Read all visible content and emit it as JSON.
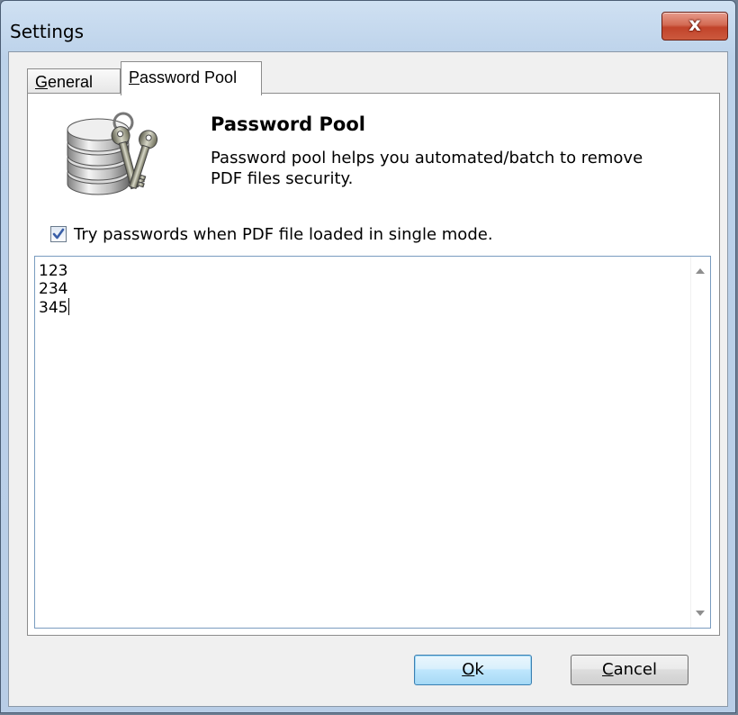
{
  "window": {
    "title": "Settings",
    "close_glyph": "x"
  },
  "tabs": [
    {
      "mnemonic": "G",
      "rest": "eneral",
      "active": false
    },
    {
      "mnemonic": "P",
      "rest": "assword Pool",
      "active": true
    }
  ],
  "panel": {
    "heading": "Password Pool",
    "description": "Password pool helps you automated/batch to remove PDF files security.",
    "icon": "database-keys-icon"
  },
  "checkbox": {
    "label": "Try passwords when PDF file loaded in single mode.",
    "checked": true
  },
  "passwords": {
    "lines": [
      "123",
      "234",
      "345"
    ]
  },
  "buttons": {
    "ok": {
      "mnemonic": "O",
      "rest": "k"
    },
    "cancel": {
      "mnemonic": "C",
      "rest": "ancel"
    }
  },
  "colors": {
    "close_button": "#c1432a",
    "ok_button_border": "#3c7fb1",
    "textarea_border": "#7a9cc0"
  }
}
